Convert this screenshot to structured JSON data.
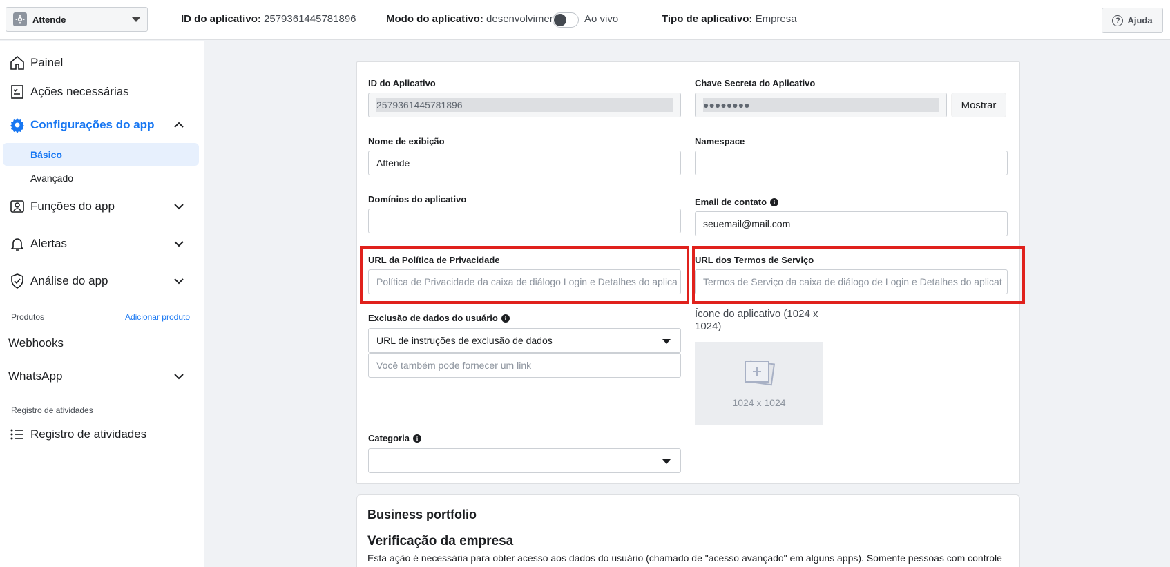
{
  "topbar": {
    "app_name": "Attende",
    "app_id_label": "ID do aplicativo:",
    "app_id_value": "2579361445781896",
    "mode_label": "Modo do aplicativo:",
    "mode_value": "desenvolvimento",
    "live_label": "Ao vivo",
    "type_label": "Tipo de aplicativo:",
    "type_value": "Empresa",
    "help_label": "Ajuda"
  },
  "sidebar": {
    "painel": "Painel",
    "acoes": "Ações necessárias",
    "config": "Configurações do app",
    "basico": "Básico",
    "avancado": "Avançado",
    "funcoes": "Funções do app",
    "alertas": "Alertas",
    "analise": "Análise do app",
    "produtos_label": "Produtos",
    "adicionar_produto": "Adicionar produto",
    "webhooks": "Webhooks",
    "whatsapp": "WhatsApp",
    "registro_section": "Registro de atividades",
    "registro_item": "Registro de atividades"
  },
  "form": {
    "app_id_label": "ID do Aplicativo",
    "app_id_value": "2579361445781896",
    "secret_label": "Chave Secreta do Aplicativo",
    "secret_value": "●●●●●●●●",
    "show_button": "Mostrar",
    "display_name_label": "Nome de exibição",
    "display_name_value": "Attende",
    "namespace_label": "Namespace",
    "namespace_value": "",
    "domains_label": "Domínios do aplicativo",
    "domains_value": "",
    "email_label": "Email de contato",
    "email_value": "seuemail@mail.com",
    "privacy_label": "URL da Política de Privacidade",
    "privacy_placeholder": "Política de Privacidade da caixa de diálogo Login e Detalhes do aplica",
    "terms_label": "URL dos Termos de Serviço",
    "terms_placeholder": "Termos de Serviço da caixa de diálogo de Login e Detalhes do aplicat",
    "deletion_label": "Exclusão de dados do usuário",
    "deletion_select": "URL de instruções de exclusão de dados",
    "deletion_link_placeholder": "Você também pode fornecer um link",
    "icon_caption": "Ícone do aplicativo (1024 x 1024)",
    "icon_size": "1024 x 1024",
    "category_label": "Categoria",
    "category_value": ""
  },
  "business": {
    "title": "Business portfolio",
    "verification_title": "Verificação da empresa",
    "verification_desc": "Esta ação é necessária para obter acesso aos dados do usuário (chamado de \"acesso avançado\" em alguns apps). Somente pessoas com controle"
  },
  "colors": {
    "accent": "#1877f2",
    "highlight": "#e0211c"
  }
}
